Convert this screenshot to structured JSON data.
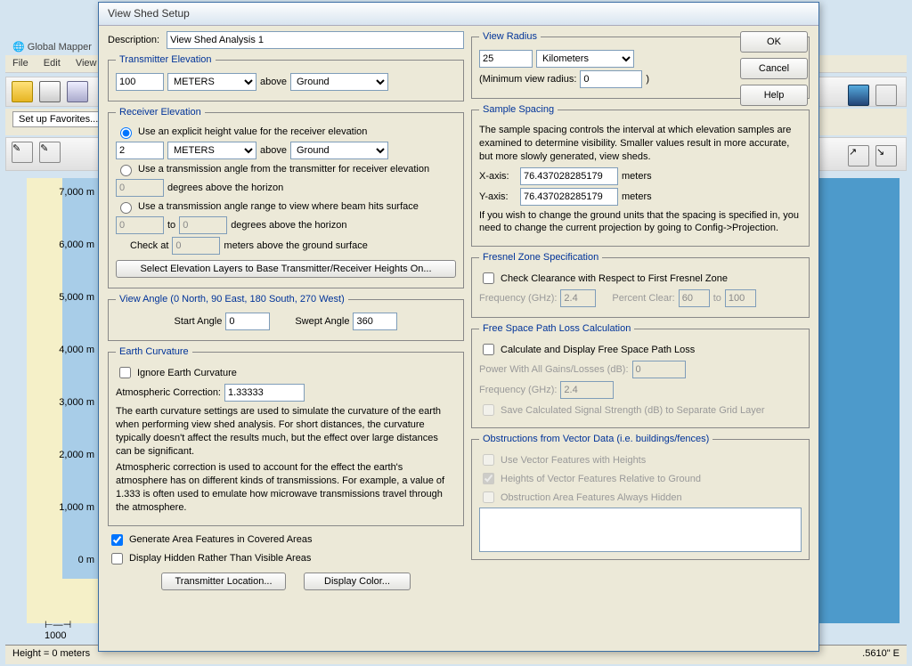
{
  "app": {
    "title": "Global Mapper",
    "menu": [
      "File",
      "Edit",
      "View"
    ],
    "favorites_label": "Set up Favorites...",
    "statusbar_left": "Height = 0 meters",
    "statusbar_right": ".5610\" E"
  },
  "scale": {
    "labels": [
      "7,000 m",
      "6,000 m",
      "5,000 m",
      "4,000 m",
      "3,000 m",
      "2,000 m",
      "1,000 m",
      "0 m"
    ],
    "bottom": "1000"
  },
  "dialog": {
    "title": "View Shed Setup",
    "description_label": "Description:",
    "description_value": "View Shed Analysis 1",
    "buttons": {
      "ok": "OK",
      "cancel": "Cancel",
      "help": "Help"
    },
    "transmitter": {
      "legend": "Transmitter Elevation",
      "value": "100",
      "unit": "METERS",
      "above_label": "above",
      "above_value": "Ground"
    },
    "receiver": {
      "legend": "Receiver Elevation",
      "opt1": "Use an explicit height value for the receiver elevation",
      "value": "2",
      "unit": "METERS",
      "above_label": "above",
      "above_value": "Ground",
      "opt2": "Use a transmission angle from the transmitter for receiver elevation",
      "angle1": "0",
      "angle1_suffix": "degrees above the horizon",
      "opt3": "Use a transmission angle range to view where beam hits surface",
      "range_from": "0",
      "range_to_label": "to",
      "range_to": "0",
      "range_suffix": "degrees above the horizon",
      "check_label": "Check at",
      "check_value": "0",
      "check_suffix": "meters above the ground surface",
      "select_layers_btn": "Select Elevation Layers to Base Transmitter/Receiver Heights On..."
    },
    "view_angle": {
      "legend": "View Angle (0 North, 90 East, 180 South, 270 West)",
      "start_label": "Start Angle",
      "start_value": "0",
      "swept_label": "Swept Angle",
      "swept_value": "360"
    },
    "earth": {
      "legend": "Earth Curvature",
      "ignore_label": "Ignore Earth Curvature",
      "atm_label": "Atmospheric Correction:",
      "atm_value": "1.33333",
      "note1": "The earth curvature settings are used to simulate the curvature of the earth when performing view shed analysis. For short distances, the curvature typically doesn't affect the results much, but the effect over large distances can be significant.",
      "note2": "Atmospheric correction is used to account for the effect the earth's atmosphere has on different kinds of transmissions. For example, a value of 1.333 is often used to emulate how microwave transmissions travel through the atmosphere."
    },
    "gen_covered": "Generate Area Features in Covered Areas",
    "display_hidden": "Display Hidden Rather Than Visible Areas",
    "transmitter_loc_btn": "Transmitter Location...",
    "display_color_btn": "Display Color...",
    "view_radius": {
      "legend": "View Radius",
      "value": "25",
      "unit": "Kilometers",
      "min_label": "(Minimum view radius:",
      "min_value": "0",
      "min_suffix": ")"
    },
    "sample": {
      "legend": "Sample Spacing",
      "note": "The sample spacing controls the interval at which elevation samples are examined to determine visibility. Smaller values result in more accurate, but more slowly generated, view sheds.",
      "x_label": "X-axis:",
      "x_value": "76.437028285179",
      "x_suffix": "meters",
      "y_label": "Y-axis:",
      "y_value": "76.437028285179",
      "y_suffix": "meters",
      "note2": "If you wish to change the ground units that the spacing is specified in, you need to change the current projection by going to Config->Projection."
    },
    "fresnel": {
      "legend": "Fresnel Zone Specification",
      "check_label": "Check Clearance with Respect to First Fresnel Zone",
      "freq_label": "Frequency (GHz):",
      "freq_value": "2.4",
      "pct_label": "Percent Clear:",
      "pct_from": "60",
      "pct_to_label": "to",
      "pct_to": "100"
    },
    "fspl": {
      "legend": "Free Space Path Loss Calculation",
      "calc_label": "Calculate and Display Free Space Path Loss",
      "power_label": "Power With All Gains/Losses (dB):",
      "power_value": "0",
      "freq_label": "Frequency (GHz):",
      "freq_value": "2.4",
      "save_label": "Save Calculated Signal Strength (dB) to Separate Grid Layer"
    },
    "obstruction": {
      "legend": "Obstructions from Vector Data (i.e. buildings/fences)",
      "opt1": "Use Vector Features with Heights",
      "opt2": "Heights of Vector Features Relative to Ground",
      "opt3": "Obstruction Area Features Always Hidden"
    }
  }
}
